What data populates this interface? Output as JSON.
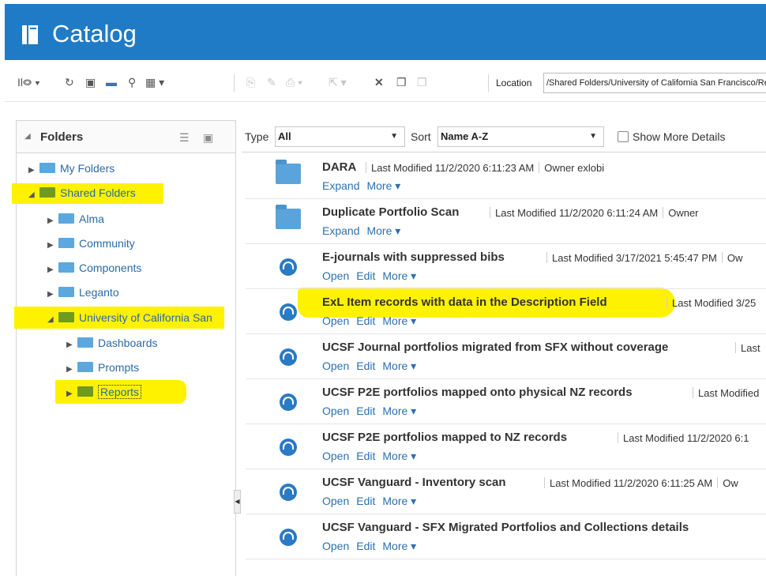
{
  "app": {
    "title": "Catalog",
    "icon": "book-icon"
  },
  "toolbar": {
    "location_label": "Location",
    "location_value": "/Shared Folders/University of California San Francisco/Reports"
  },
  "folders_panel": {
    "title": "Folders",
    "tree": [
      {
        "label": "My Folders",
        "color": "#5ba8df"
      },
      {
        "label": "Shared Folders",
        "color": "#6e9a1f"
      },
      {
        "label": "Alma",
        "color": "#5ba8df"
      },
      {
        "label": "Community",
        "color": "#5ba8df"
      },
      {
        "label": "Components",
        "color": "#5ba8df"
      },
      {
        "label": "Leganto",
        "color": "#5ba8df"
      },
      {
        "label": "University of California San",
        "color": "#6e9a1f"
      },
      {
        "label": "Dashboards",
        "color": "#5ba8df"
      },
      {
        "label": "Prompts",
        "color": "#5ba8df"
      },
      {
        "label": "Reports",
        "color": "#6e9a1f"
      }
    ]
  },
  "filter": {
    "type_label": "Type",
    "type_value": "All",
    "sort_label": "Sort",
    "sort_value": "Name A-Z",
    "show_more_label": "Show More Details"
  },
  "items": [
    {
      "name": "DARA",
      "meta": "Last Modified 11/2/2020 6:11:23 AM",
      "owner": "Owner exlobi",
      "a1": "Expand",
      "a2": "More ▾",
      "a3": ""
    },
    {
      "name": "Duplicate Portfolio Scan",
      "meta": "Last Modified 11/2/2020 6:11:24 AM",
      "owner": "Owner",
      "a1": "Expand",
      "a2": "More ▾",
      "a3": ""
    },
    {
      "name": "E-journals with suppressed bibs",
      "meta": "Last Modified 3/17/2021 5:45:47 PM",
      "owner": "Ow",
      "a1": "Open",
      "a2": "Edit",
      "a3": "More ▾"
    },
    {
      "name": "ExL Item records with data in the Description Field",
      "meta": "Last Modified 3/25",
      "owner": "",
      "a1": "Open",
      "a2": "Edit",
      "a3": "More ▾"
    },
    {
      "name": "UCSF Journal portfolios migrated from SFX without coverage",
      "meta": "Last",
      "owner": "",
      "a1": "Open",
      "a2": "Edit",
      "a3": "More ▾"
    },
    {
      "name": "UCSF P2E portfolios mapped onto physical NZ records",
      "meta": "Last Modified",
      "owner": "",
      "a1": "Open",
      "a2": "Edit",
      "a3": "More ▾"
    },
    {
      "name": "UCSF P2E portfolios mapped to NZ records",
      "meta": "Last Modified 11/2/2020 6:1",
      "owner": "",
      "a1": "Open",
      "a2": "Edit",
      "a3": "More ▾"
    },
    {
      "name": "UCSF Vanguard - Inventory scan",
      "meta": "Last Modified 11/2/2020 6:11:25 AM",
      "owner": "Ow",
      "a1": "Open",
      "a2": "Edit",
      "a3": "More ▾"
    },
    {
      "name": "UCSF Vanguard - SFX Migrated Portfolios and Collections details",
      "meta": "",
      "owner": "",
      "a1": "Open",
      "a2": "Edit",
      "a3": "More ▾"
    }
  ],
  "highlight_color": "#fff200"
}
